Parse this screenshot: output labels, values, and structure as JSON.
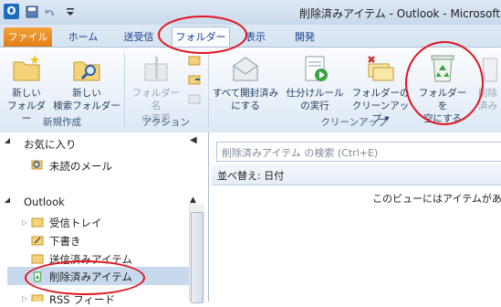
{
  "window": {
    "title": "削除済みアイテム - Outlook - Microsoft O"
  },
  "tabs": [
    {
      "label": "ファイル"
    },
    {
      "label": "ホーム"
    },
    {
      "label": "送受信"
    },
    {
      "label": "フォルダー"
    },
    {
      "label": "表示"
    },
    {
      "label": "開発"
    }
  ],
  "ribbon": {
    "groups": {
      "new": "新規作成",
      "actions": "アクション",
      "cleanup": "クリーンアップ"
    },
    "buttons": {
      "new_folder": [
        "新しい",
        "フォルダー"
      ],
      "new_search_folder": [
        "新しい",
        "検索フォルダー"
      ],
      "rename_folder": [
        "フォルダー名",
        "の変更"
      ],
      "mark_all_read": [
        "すべて開封済み",
        "にする"
      ],
      "run_rules": [
        "仕分けルール",
        "の実行"
      ],
      "cleanup_folder": [
        "フォルダーの",
        "クリーンアップ ▾"
      ],
      "empty_folder": [
        "フォルダーを",
        "空にする"
      ],
      "delete_all": [
        "削除",
        "済み"
      ]
    }
  },
  "nav": {
    "favorites": "お気に入り",
    "unread": "未読のメール",
    "account": "Outlook",
    "inbox": "受信トレイ",
    "drafts": "下書き",
    "sent": "送信済みアイテム",
    "deleted": "削除済みアイテム",
    "rss": "RSS フィード"
  },
  "main": {
    "search_placeholder": "削除済みアイテム の検索 (Ctrl+E)",
    "sort_label": "並べ替え: 日付",
    "empty_message": "このビューにはアイテムがありま"
  },
  "colors": {
    "accent": "#e07b12",
    "highlight": "#e0141e"
  }
}
